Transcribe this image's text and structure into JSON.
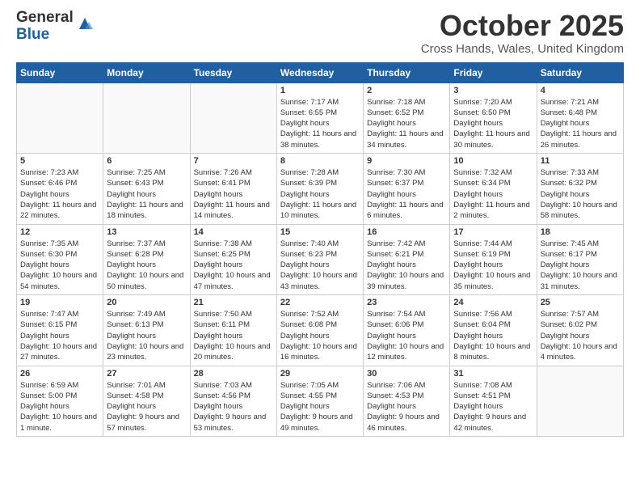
{
  "header": {
    "logo_general": "General",
    "logo_blue": "Blue",
    "month_title": "October 2025",
    "location": "Cross Hands, Wales, United Kingdom"
  },
  "days_of_week": [
    "Sunday",
    "Monday",
    "Tuesday",
    "Wednesday",
    "Thursday",
    "Friday",
    "Saturday"
  ],
  "weeks": [
    [
      {
        "day": "",
        "empty": true
      },
      {
        "day": "",
        "empty": true
      },
      {
        "day": "",
        "empty": true
      },
      {
        "day": "1",
        "sunrise": "7:17 AM",
        "sunset": "6:55 PM",
        "daylight": "11 hours and 38 minutes."
      },
      {
        "day": "2",
        "sunrise": "7:18 AM",
        "sunset": "6:52 PM",
        "daylight": "11 hours and 34 minutes."
      },
      {
        "day": "3",
        "sunrise": "7:20 AM",
        "sunset": "6:50 PM",
        "daylight": "11 hours and 30 minutes."
      },
      {
        "day": "4",
        "sunrise": "7:21 AM",
        "sunset": "6:48 PM",
        "daylight": "11 hours and 26 minutes."
      }
    ],
    [
      {
        "day": "5",
        "sunrise": "7:23 AM",
        "sunset": "6:46 PM",
        "daylight": "11 hours and 22 minutes."
      },
      {
        "day": "6",
        "sunrise": "7:25 AM",
        "sunset": "6:43 PM",
        "daylight": "11 hours and 18 minutes."
      },
      {
        "day": "7",
        "sunrise": "7:26 AM",
        "sunset": "6:41 PM",
        "daylight": "11 hours and 14 minutes."
      },
      {
        "day": "8",
        "sunrise": "7:28 AM",
        "sunset": "6:39 PM",
        "daylight": "11 hours and 10 minutes."
      },
      {
        "day": "9",
        "sunrise": "7:30 AM",
        "sunset": "6:37 PM",
        "daylight": "11 hours and 6 minutes."
      },
      {
        "day": "10",
        "sunrise": "7:32 AM",
        "sunset": "6:34 PM",
        "daylight": "11 hours and 2 minutes."
      },
      {
        "day": "11",
        "sunrise": "7:33 AM",
        "sunset": "6:32 PM",
        "daylight": "10 hours and 58 minutes."
      }
    ],
    [
      {
        "day": "12",
        "sunrise": "7:35 AM",
        "sunset": "6:30 PM",
        "daylight": "10 hours and 54 minutes."
      },
      {
        "day": "13",
        "sunrise": "7:37 AM",
        "sunset": "6:28 PM",
        "daylight": "10 hours and 50 minutes."
      },
      {
        "day": "14",
        "sunrise": "7:38 AM",
        "sunset": "6:25 PM",
        "daylight": "10 hours and 47 minutes."
      },
      {
        "day": "15",
        "sunrise": "7:40 AM",
        "sunset": "6:23 PM",
        "daylight": "10 hours and 43 minutes."
      },
      {
        "day": "16",
        "sunrise": "7:42 AM",
        "sunset": "6:21 PM",
        "daylight": "10 hours and 39 minutes."
      },
      {
        "day": "17",
        "sunrise": "7:44 AM",
        "sunset": "6:19 PM",
        "daylight": "10 hours and 35 minutes."
      },
      {
        "day": "18",
        "sunrise": "7:45 AM",
        "sunset": "6:17 PM",
        "daylight": "10 hours and 31 minutes."
      }
    ],
    [
      {
        "day": "19",
        "sunrise": "7:47 AM",
        "sunset": "6:15 PM",
        "daylight": "10 hours and 27 minutes."
      },
      {
        "day": "20",
        "sunrise": "7:49 AM",
        "sunset": "6:13 PM",
        "daylight": "10 hours and 23 minutes."
      },
      {
        "day": "21",
        "sunrise": "7:50 AM",
        "sunset": "6:11 PM",
        "daylight": "10 hours and 20 minutes."
      },
      {
        "day": "22",
        "sunrise": "7:52 AM",
        "sunset": "6:08 PM",
        "daylight": "10 hours and 16 minutes."
      },
      {
        "day": "23",
        "sunrise": "7:54 AM",
        "sunset": "6:06 PM",
        "daylight": "10 hours and 12 minutes."
      },
      {
        "day": "24",
        "sunrise": "7:56 AM",
        "sunset": "6:04 PM",
        "daylight": "10 hours and 8 minutes."
      },
      {
        "day": "25",
        "sunrise": "7:57 AM",
        "sunset": "6:02 PM",
        "daylight": "10 hours and 4 minutes."
      }
    ],
    [
      {
        "day": "26",
        "sunrise": "6:59 AM",
        "sunset": "5:00 PM",
        "daylight": "10 hours and 1 minute."
      },
      {
        "day": "27",
        "sunrise": "7:01 AM",
        "sunset": "4:58 PM",
        "daylight": "9 hours and 57 minutes."
      },
      {
        "day": "28",
        "sunrise": "7:03 AM",
        "sunset": "4:56 PM",
        "daylight": "9 hours and 53 minutes."
      },
      {
        "day": "29",
        "sunrise": "7:05 AM",
        "sunset": "4:55 PM",
        "daylight": "9 hours and 49 minutes."
      },
      {
        "day": "30",
        "sunrise": "7:06 AM",
        "sunset": "4:53 PM",
        "daylight": "9 hours and 46 minutes."
      },
      {
        "day": "31",
        "sunrise": "7:08 AM",
        "sunset": "4:51 PM",
        "daylight": "9 hours and 42 minutes."
      },
      {
        "day": "",
        "empty": true
      }
    ]
  ]
}
